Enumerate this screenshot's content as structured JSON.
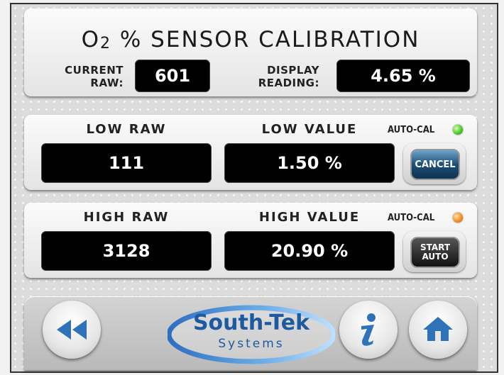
{
  "screen": {
    "title_prefix": "O",
    "title_sub": "2",
    "title_rest": " % SENSOR CALIBRATION",
    "current_raw_label_1": "CURRENT",
    "current_raw_label_2": "RAW:",
    "current_raw_value": "601",
    "display_reading_label_1": "DISPLAY",
    "display_reading_label_2": "READING:",
    "display_reading_value": "4.65 %"
  },
  "low": {
    "raw_label": "LOW RAW",
    "value_label": "LOW VALUE",
    "raw_value": "111",
    "value": "1.50 %",
    "autocal_label": "AUTO-CAL",
    "autocal_led": "green",
    "button_label": "CANCEL"
  },
  "high": {
    "raw_label": "HIGH RAW",
    "value_label": "HIGH VALUE",
    "raw_value": "3128",
    "value": "20.90 %",
    "autocal_label": "AUTO-CAL",
    "autocal_led": "orange",
    "button_line1": "START",
    "button_line2": "AUTO"
  },
  "footer": {
    "back_icon": "rewind-icon",
    "info_icon": "info-icon",
    "home_icon": "home-icon",
    "logo_line1": "South-Tek",
    "logo_line2": "Systems"
  },
  "colors": {
    "value_box": "#000000",
    "led_green": "#4ecb2a",
    "led_orange": "#f49024",
    "icon_blue": "#2f72b8",
    "logo_blue": "#1e5aa0"
  }
}
